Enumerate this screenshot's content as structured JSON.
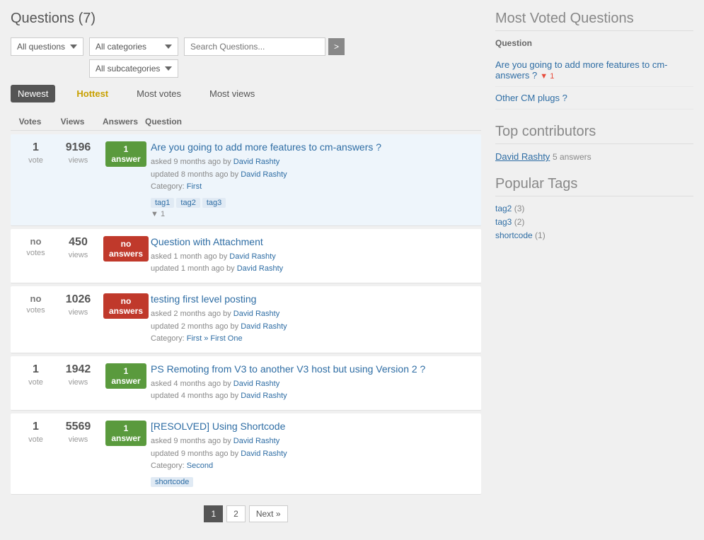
{
  "page": {
    "title": "Questions (7)"
  },
  "filters": {
    "all_questions_label": "All questions",
    "all_categories_label": "All categories",
    "all_subcategories_label": "All subcategories",
    "search_placeholder": "Search Questions...",
    "search_btn_label": ">"
  },
  "tabs": [
    {
      "id": "newest",
      "label": "Newest",
      "active": true
    },
    {
      "id": "hottest",
      "label": "Hottest",
      "active": false
    },
    {
      "id": "most_votes",
      "label": "Most votes",
      "active": false
    },
    {
      "id": "most_views",
      "label": "Most views",
      "active": false
    }
  ],
  "columns": {
    "votes": "Votes",
    "views": "Views",
    "answers": "Answers",
    "question": "Question"
  },
  "questions": [
    {
      "id": 1,
      "votes": "1",
      "vote_label": "vote",
      "views": "9196",
      "views_label": "views",
      "answers": "1",
      "answer_label": "answer",
      "answer_type": "green",
      "title": "Are you going to add more features to cm-answers ?",
      "asked_time": "asked 9 months ago",
      "updated_time": "updated 8 months ago",
      "author": "David Rashty",
      "category": "First",
      "tags": [
        "tag1",
        "tag2",
        "tag3"
      ],
      "vote_count": "▼ 1",
      "highlighted": true
    },
    {
      "id": 2,
      "votes": "no",
      "vote_label": "votes",
      "views": "450",
      "views_label": "views",
      "answers": "no",
      "answer_label": "answers",
      "answer_type": "red",
      "title": "Question with Attachment",
      "asked_time": "asked 1 month ago",
      "updated_time": "updated 1 month ago",
      "author": "David Rashty",
      "category": "",
      "tags": [],
      "vote_count": "",
      "highlighted": false
    },
    {
      "id": 3,
      "votes": "no",
      "vote_label": "votes",
      "views": "1026",
      "views_label": "views",
      "answers": "no",
      "answer_label": "answers",
      "answer_type": "red",
      "title": "testing first level posting",
      "asked_time": "asked 2 months ago",
      "updated_time": "updated 2 months ago",
      "author": "David Rashty",
      "category_path": "First » First One",
      "tags": [],
      "vote_count": "",
      "highlighted": false
    },
    {
      "id": 4,
      "votes": "1",
      "vote_label": "vote",
      "views": "1942",
      "views_label": "views",
      "answers": "1",
      "answer_label": "answer",
      "answer_type": "green",
      "title": "PS Remoting from V3 to another V3 host but using Version 2 ?",
      "asked_time": "asked 4 months ago",
      "updated_time": "updated 4 months ago",
      "author": "David Rashty",
      "category": "",
      "tags": [],
      "vote_count": "",
      "highlighted": false
    },
    {
      "id": 5,
      "votes": "1",
      "vote_label": "vote",
      "views": "5569",
      "views_label": "views",
      "answers": "1",
      "answer_label": "answer",
      "answer_type": "green",
      "title": "[RESOLVED] Using Shortcode",
      "asked_time": "asked 9 months ago",
      "updated_time": "updated 9 months ago",
      "author": "David Rashty",
      "category": "Second",
      "tags": [
        "shortcode"
      ],
      "vote_count": "",
      "highlighted": false
    }
  ],
  "pagination": {
    "pages": [
      "1",
      "2"
    ],
    "next_label": "Next »",
    "active_page": "1"
  },
  "sidebar": {
    "most_voted_title": "Most Voted Questions",
    "question_col": "Question",
    "most_voted_items": [
      {
        "title": "Are you going to add more features to cm-answers ?",
        "votes": "▼ 1"
      },
      {
        "title": "Other CM plugs ?",
        "votes": ""
      }
    ],
    "top_contributors_title": "Top contributors",
    "contributors": [
      {
        "name": "David Rashty",
        "answers": "5 answers"
      }
    ],
    "popular_tags_title": "Popular Tags",
    "tags": [
      {
        "name": "tag2",
        "count": "(3)"
      },
      {
        "name": "tag3",
        "count": "(2)"
      },
      {
        "name": "shortcode",
        "count": "(1)"
      }
    ]
  }
}
